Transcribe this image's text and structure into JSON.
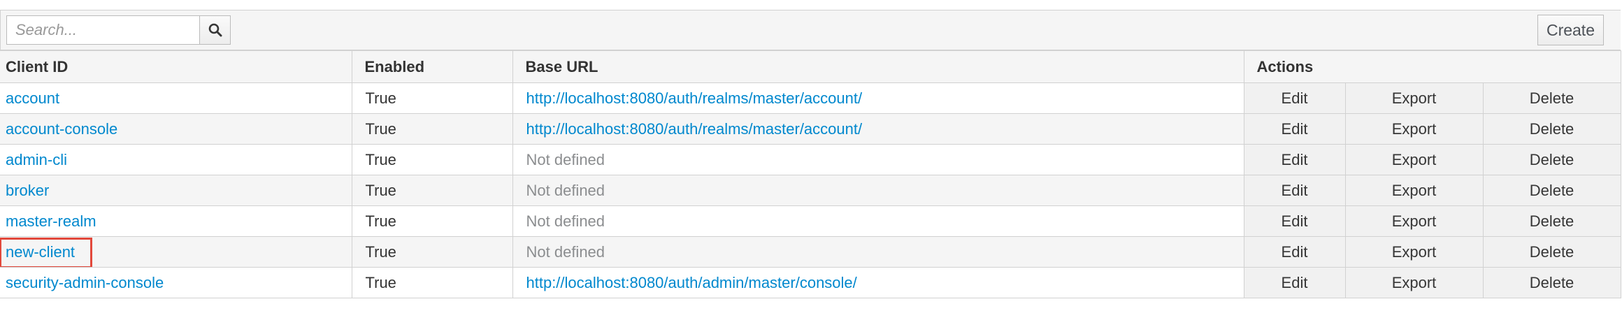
{
  "search": {
    "placeholder": "Search..."
  },
  "toolbar": {
    "create_label": "Create"
  },
  "columns": {
    "client_id": "Client ID",
    "enabled": "Enabled",
    "base_url": "Base URL",
    "actions": "Actions"
  },
  "rows": [
    {
      "client_id": "account",
      "enabled": "True",
      "base_url": "http://localhost:8080/auth/realms/master/account/",
      "url_defined": true
    },
    {
      "client_id": "account-console",
      "enabled": "True",
      "base_url": "http://localhost:8080/auth/realms/master/account/",
      "url_defined": true
    },
    {
      "client_id": "admin-cli",
      "enabled": "True",
      "base_url": "Not defined",
      "url_defined": false
    },
    {
      "client_id": "broker",
      "enabled": "True",
      "base_url": "Not defined",
      "url_defined": false
    },
    {
      "client_id": "master-realm",
      "enabled": "True",
      "base_url": "Not defined",
      "url_defined": false
    },
    {
      "client_id": "new-client",
      "enabled": "True",
      "base_url": "Not defined",
      "url_defined": false,
      "highlighted": true
    },
    {
      "client_id": "security-admin-console",
      "enabled": "True",
      "base_url": "http://localhost:8080/auth/admin/master/console/",
      "url_defined": true
    }
  ],
  "action_labels": {
    "edit": "Edit",
    "export": "Export",
    "delete": "Delete"
  },
  "icons": {
    "search_button": "search-icon"
  },
  "colors": {
    "link": "#0088ce",
    "muted": "#8b8d8f",
    "highlight": "#e2483b"
  }
}
